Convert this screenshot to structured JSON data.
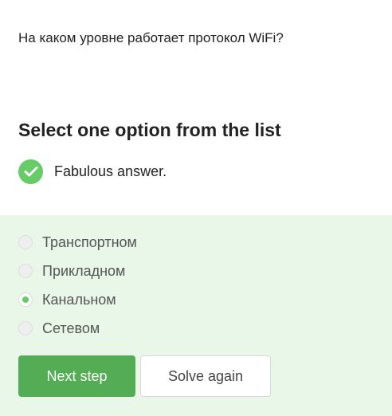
{
  "question": {
    "text": "На каком уровне работает протокол WiFi?"
  },
  "prompt": {
    "text": "Select one option from the list"
  },
  "feedback": {
    "icon": "check-circle-icon",
    "text": "Fabulous answer.",
    "color": "#66cc66"
  },
  "options": [
    {
      "label": "Транспортном",
      "selected": false
    },
    {
      "label": "Прикладном",
      "selected": false
    },
    {
      "label": "Канальном",
      "selected": true
    },
    {
      "label": "Сетевом",
      "selected": false
    }
  ],
  "buttons": {
    "next_label": "Next step",
    "solve_again_label": "Solve again"
  },
  "colors": {
    "accent": "#54ad54",
    "panel_background": "#e9f7e9"
  }
}
